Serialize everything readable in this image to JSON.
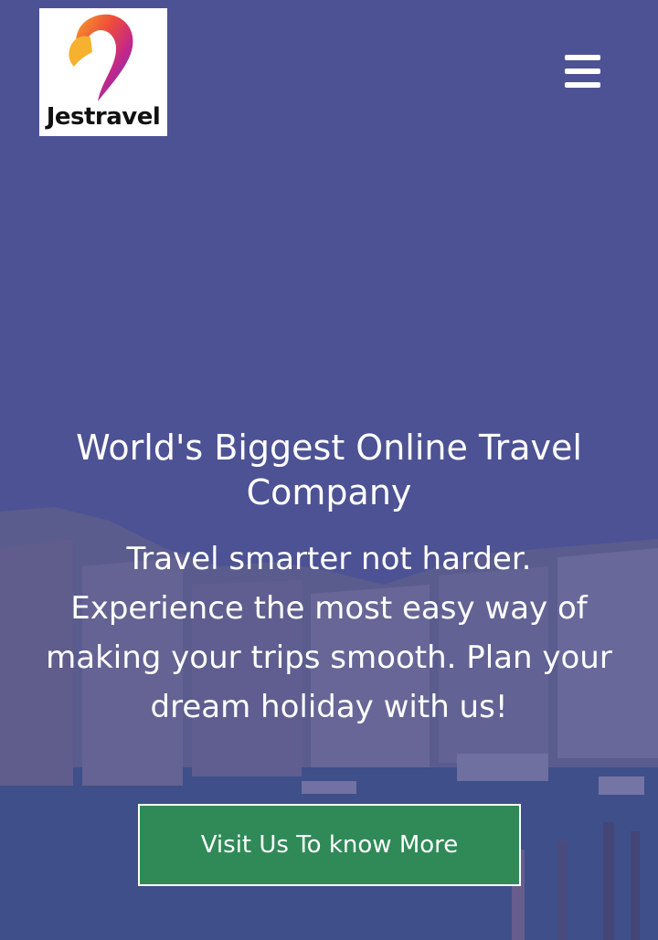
{
  "brand": {
    "name": "Jestravel",
    "logo_icon": "map-pin-logo-icon"
  },
  "header": {
    "menu_icon": "hamburger-menu-icon"
  },
  "hero": {
    "headline": "World's Biggest Online Travel Company",
    "tagline": "Travel smarter not harder. Experience the most easy way of making your trips smooth. Plan your dream holiday with us!",
    "cta_label": "Visit Us To know More"
  },
  "colors": {
    "overlay": "#4f5590",
    "cta_background": "#2f8a57",
    "text": "#ffffff"
  }
}
